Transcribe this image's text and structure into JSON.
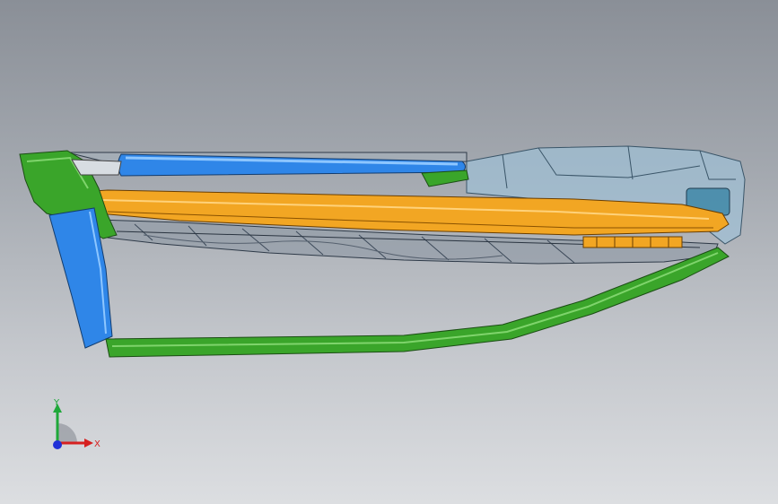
{
  "viewport": {
    "background_top": "#8a8f97",
    "background_bottom": "#dcdee1"
  },
  "model": {
    "colors": {
      "green": "#3aa52a",
      "blue": "#2f86e8",
      "orange": "#f2a623",
      "shell": "#9ec2d8",
      "frame": "#8b95a3"
    }
  },
  "triad": {
    "x_label": "X",
    "y_label": "Y",
    "x_color": "#d62020",
    "y_color": "#1fa83a",
    "z_color": "#2030d8"
  }
}
